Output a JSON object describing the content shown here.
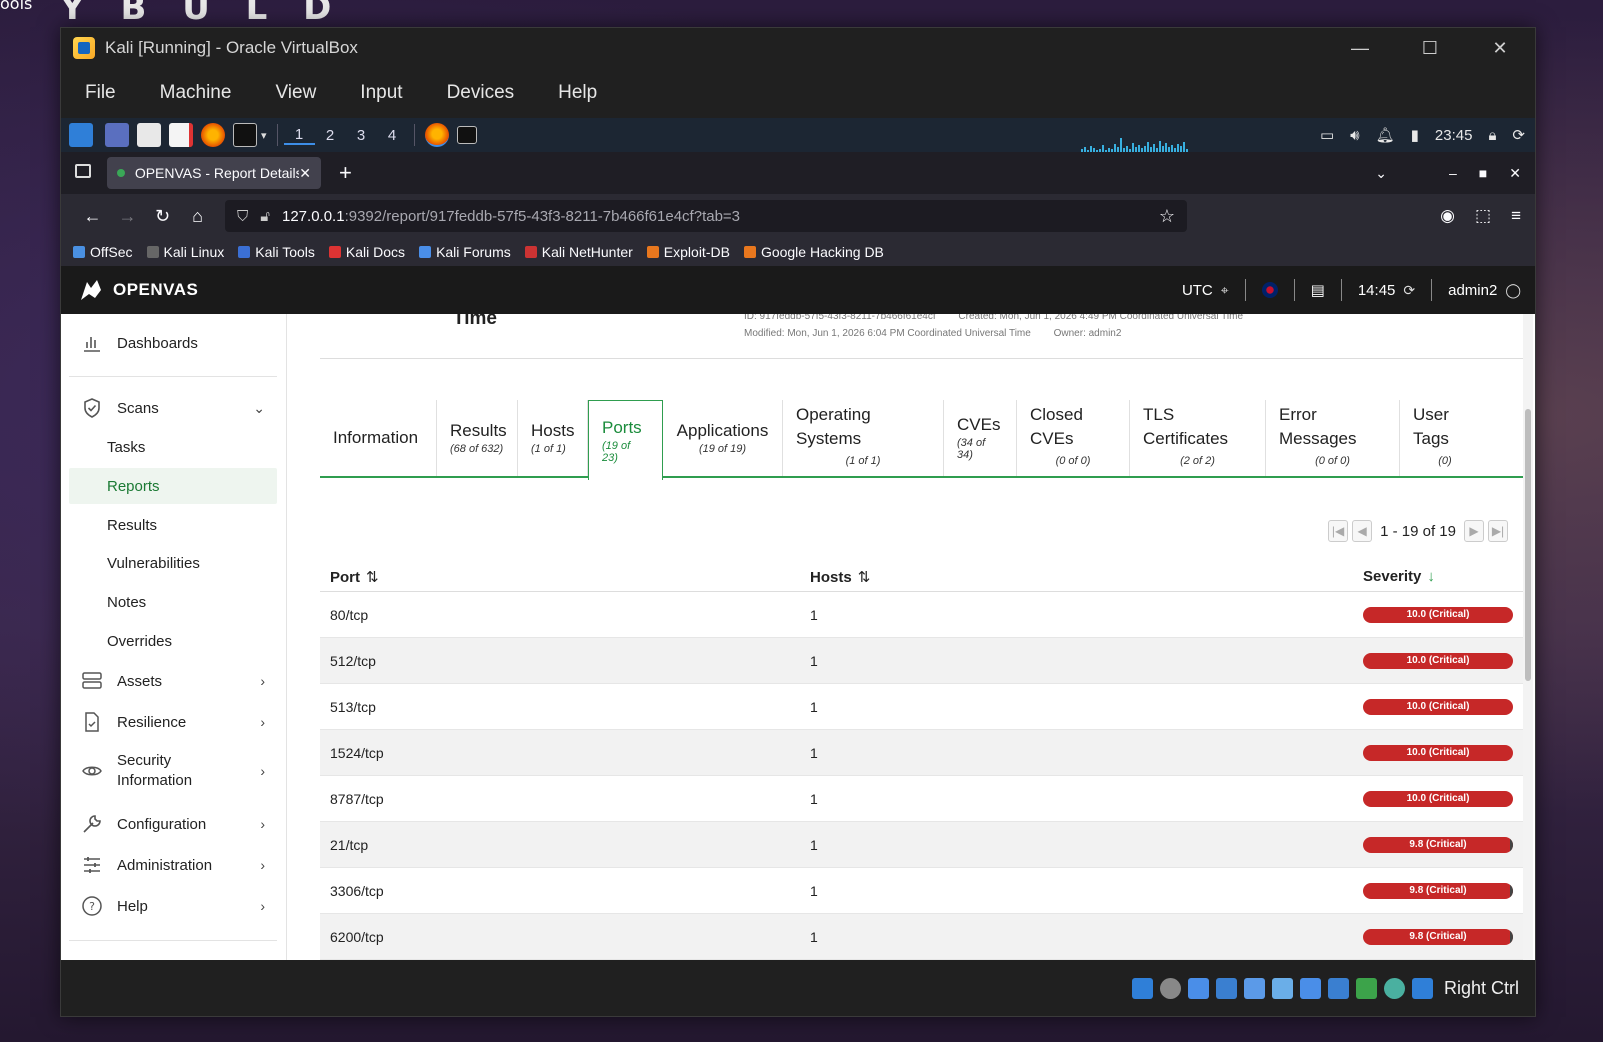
{
  "desktop": {
    "corner_text": "ools",
    "banner_text": "Y B U L D"
  },
  "vbox": {
    "title": "Kali [Running] - Oracle VirtualBox",
    "menu": [
      "File",
      "Machine",
      "View",
      "Input",
      "Devices",
      "Help"
    ],
    "host_key": "Right Ctrl"
  },
  "kali_panel": {
    "workspaces": [
      "1",
      "2",
      "3",
      "4"
    ],
    "clock": "23:45"
  },
  "firefox": {
    "tab_title": "OPENVAS - Report Details",
    "url_host": "127.0.0.1",
    "url_rest": ":9392/report/917feddb-57f5-43f3-8211-7b466f61e4cf?tab=3",
    "bookmarks": [
      "OffSec",
      "Kali Linux",
      "Kali Tools",
      "Kali Docs",
      "Kali Forums",
      "Kali NetHunter",
      "Exploit-DB",
      "Google Hacking DB"
    ]
  },
  "openvas": {
    "logo": "OPENVAS",
    "timezone": "UTC",
    "time": "14:45",
    "user": "admin2",
    "sidebar": {
      "dashboards": "Dashboards",
      "scans": "Scans",
      "scans_sub": [
        "Tasks",
        "Reports",
        "Results",
        "Vulnerabilities",
        "Notes",
        "Overrides"
      ],
      "assets": "Assets",
      "resilience": "Resilience",
      "security_info_1": "Security",
      "security_info_2": "Information",
      "configuration": "Configuration",
      "administration": "Administration",
      "help": "Help"
    },
    "report_meta": {
      "title_fragment": "Time",
      "id": "ID: 917feddb-57f5-43f3-8211-7b466f61e4cf",
      "created": "Created: Mon, Jun 1, 2026 4:49 PM Coordinated Universal Time",
      "modified": "Modified: Mon, Jun 1, 2026 6:04 PM Coordinated Universal Time",
      "owner": "Owner: admin2"
    },
    "tabs": [
      {
        "label": "Information",
        "count": ""
      },
      {
        "label": "Results",
        "count": "(68 of 632)"
      },
      {
        "label": "Hosts",
        "count": "(1 of 1)"
      },
      {
        "label": "Ports",
        "count": "(19 of 23)"
      },
      {
        "label": "Applications",
        "count": "(19 of 19)"
      },
      {
        "label": "Operating Systems",
        "count": "(1 of 1)"
      },
      {
        "label": "CVEs",
        "count": "(34 of 34)"
      },
      {
        "label": "Closed CVEs",
        "count": "(0 of 0)"
      },
      {
        "label": "TLS Certificates",
        "count": "(2 of 2)"
      },
      {
        "label": "Error Messages",
        "count": "(0 of 0)"
      },
      {
        "label": "User Tags",
        "count": "(0)"
      }
    ],
    "pagination": "1 - 19 of 19",
    "table": {
      "headers": {
        "port": "Port",
        "hosts": "Hosts",
        "severity": "Severity"
      },
      "rows": [
        {
          "port": "80/tcp",
          "hosts": "1",
          "severity": "10.0 (Critical)",
          "score": 10.0
        },
        {
          "port": "512/tcp",
          "hosts": "1",
          "severity": "10.0 (Critical)",
          "score": 10.0
        },
        {
          "port": "513/tcp",
          "hosts": "1",
          "severity": "10.0 (Critical)",
          "score": 10.0
        },
        {
          "port": "1524/tcp",
          "hosts": "1",
          "severity": "10.0 (Critical)",
          "score": 10.0
        },
        {
          "port": "8787/tcp",
          "hosts": "1",
          "severity": "10.0 (Critical)",
          "score": 10.0
        },
        {
          "port": "21/tcp",
          "hosts": "1",
          "severity": "9.8 (Critical)",
          "score": 9.8
        },
        {
          "port": "3306/tcp",
          "hosts": "1",
          "severity": "9.8 (Critical)",
          "score": 9.8
        },
        {
          "port": "6200/tcp",
          "hosts": "1",
          "severity": "9.8 (Critical)",
          "score": 9.8
        }
      ]
    }
  },
  "colors": {
    "openvas_green": "#2f9d4f",
    "critical": "#c62828"
  }
}
